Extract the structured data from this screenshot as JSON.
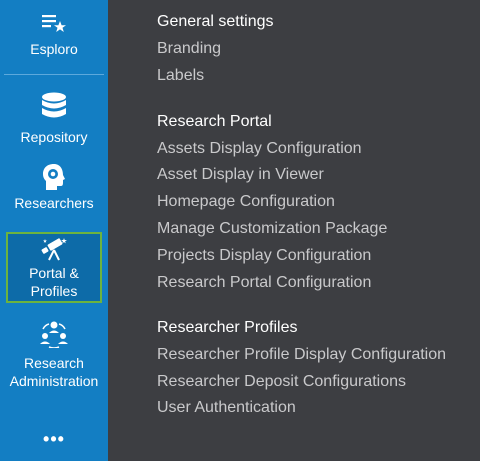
{
  "sidebar": {
    "items": [
      {
        "label": "Esploro",
        "icon": "list-star-icon"
      },
      {
        "label": "Repository",
        "icon": "database-icon"
      },
      {
        "label": "Researchers",
        "icon": "head-brain-icon"
      },
      {
        "label": "Portal & Profiles",
        "icon": "telescope-icon",
        "active": true
      },
      {
        "label": "Research Administration",
        "icon": "people-network-icon"
      }
    ],
    "more_label": "•••"
  },
  "menu": {
    "sections": [
      {
        "title": "General settings",
        "links": [
          "Branding",
          "Labels"
        ]
      },
      {
        "title": "Research Portal",
        "links": [
          "Assets Display Configuration",
          "Asset Display in Viewer",
          "Homepage Configuration",
          "Manage Customization Package",
          "Projects Display Configuration",
          "Research Portal Configuration"
        ]
      },
      {
        "title": "Researcher Profiles",
        "links": [
          "Researcher Profile Display Configuration",
          "Researcher Deposit Configurations",
          "User Authentication"
        ]
      }
    ]
  },
  "colors": {
    "sidebar_bg": "#137ec3",
    "content_bg": "#3d3e42",
    "active_border": "#6cb33f",
    "link_text": "#c9c9cb"
  }
}
